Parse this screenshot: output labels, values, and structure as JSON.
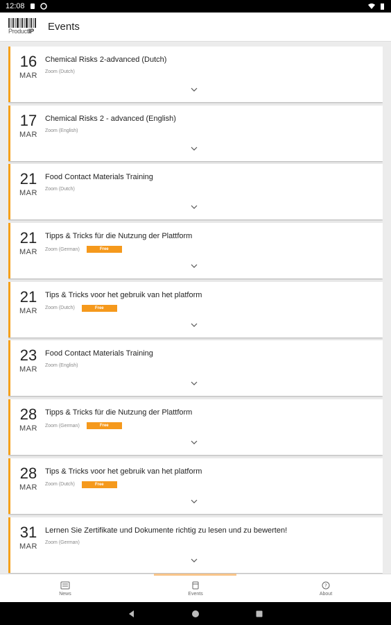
{
  "status_bar": {
    "time": "12:08"
  },
  "app_bar": {
    "logo_text_a": "Product",
    "logo_text_b": "IP",
    "title": "Events"
  },
  "accent_color": "#f5a01a",
  "events": [
    {
      "day": "16",
      "month": "MAR",
      "title": "Chemical Risks 2-advanced (Dutch)",
      "location": "Zoom (Dutch)",
      "badge": ""
    },
    {
      "day": "17",
      "month": "MAR",
      "title": "Chemical Risks 2 - advanced (English)",
      "location": "Zoom (English)",
      "badge": ""
    },
    {
      "day": "21",
      "month": "MAR",
      "title": "Food Contact Materials Training",
      "location": "Zoom (Dutch)",
      "badge": ""
    },
    {
      "day": "21",
      "month": "MAR",
      "title": "Tipps & Tricks für die Nutzung der Plattform",
      "location": "Zoom (German)",
      "badge": "Free"
    },
    {
      "day": "21",
      "month": "MAR",
      "title": "Tips & Tricks voor het gebruik van het platform",
      "location": "Zoom (Dutch)",
      "badge": "Free"
    },
    {
      "day": "23",
      "month": "MAR",
      "title": "Food Contact Materials Training",
      "location": "Zoom (English)",
      "badge": ""
    },
    {
      "day": "28",
      "month": "MAR",
      "title": "Tipps & Tricks für die Nutzung der Plattform",
      "location": "Zoom (German)",
      "badge": "Free"
    },
    {
      "day": "28",
      "month": "MAR",
      "title": "Tips & Tricks voor het gebruik van het platform",
      "location": "Zoom (Dutch)",
      "badge": "Free"
    },
    {
      "day": "31",
      "month": "MAR",
      "title": "Lernen Sie Zertifikate und Dokumente richtig zu lesen und zu bewerten!",
      "location": "Zoom (German)",
      "badge": ""
    }
  ],
  "bottom_nav": [
    {
      "label": "News",
      "icon": "news-icon"
    },
    {
      "label": "Events",
      "icon": "calendar-icon"
    },
    {
      "label": "About",
      "icon": "help-icon"
    }
  ]
}
